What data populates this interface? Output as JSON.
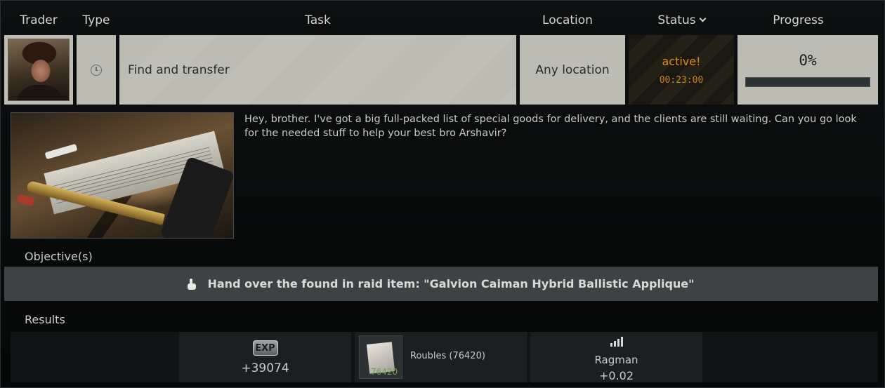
{
  "header": {
    "trader": "Trader",
    "type": "Type",
    "task": "Task",
    "location": "Location",
    "status": "Status",
    "progress": "Progress"
  },
  "row": {
    "task_name": "Find and transfer",
    "location": "Any location",
    "status": "active!",
    "timer": "00:23:00",
    "progress_text": "0%",
    "progress_value": 0,
    "type_icon": "clock-icon"
  },
  "description": "Hey, brother. I've got a big full-packed list of special goods for delivery, and the clients are still waiting. Can you go look for the needed stuff to help your best bro Arshavir?",
  "objectives": {
    "label": "Objective(s)",
    "items": [
      {
        "text": "Hand over the found in raid item: \"Galvion Caiman Hybrid Ballistic Applique\"",
        "icon": "hand-icon"
      }
    ]
  },
  "results": {
    "label": "Results",
    "exp": {
      "badge": "EXP",
      "value": "+39074"
    },
    "roubles": {
      "qty": "76420",
      "label": "Roubles (76420)"
    },
    "reputation": {
      "trader": "Ragman",
      "value": "+0.02"
    }
  },
  "colors": {
    "status_active": "#d88d1c",
    "cell_bg": "#bdbcb2",
    "objective_bg": "#3e4245"
  }
}
